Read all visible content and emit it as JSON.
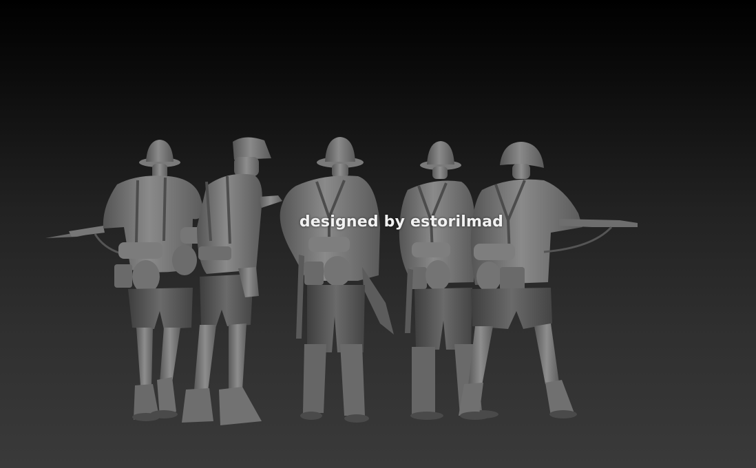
{
  "watermark": {
    "text": "designed by estorilmad"
  },
  "colors": {
    "background_top": "#000000",
    "background_bottom": "#3a3a3a",
    "figure_light": "#8f8f8f",
    "figure_mid": "#6e6e6e",
    "figure_dark": "#4a4a4a",
    "watermark_text": "#f2f2f2"
  },
  "figures": [
    {
      "id": "soldier-1",
      "headgear": "pith-helmet",
      "legwear": "shorts",
      "holding": "rifle-with-bayonet"
    },
    {
      "id": "soldier-2",
      "headgear": "field-cap",
      "legwear": "shorts",
      "holding": "pointing"
    },
    {
      "id": "soldier-3",
      "headgear": "pith-helmet",
      "legwear": "trousers-boots",
      "holding": "none"
    },
    {
      "id": "soldier-4",
      "headgear": "pith-helmet",
      "legwear": "trousers-boots",
      "holding": "none"
    },
    {
      "id": "soldier-5",
      "headgear": "steel-helmet",
      "legwear": "shorts",
      "holding": "rifle"
    }
  ]
}
